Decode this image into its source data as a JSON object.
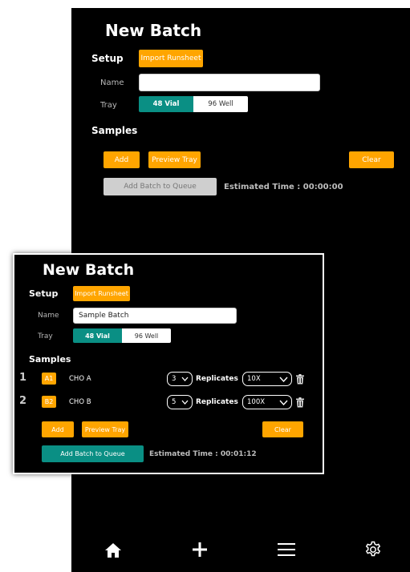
{
  "back_screen": {
    "title": "New Batch",
    "setup_label": "Setup",
    "import_button": "Import Runsheet",
    "name_label": "Name",
    "name_value": "",
    "tray_label": "Tray",
    "tray_options": [
      "48 Vial",
      "96 Well"
    ],
    "tray_selected": "48 Vial",
    "samples_label": "Samples",
    "add_button": "Add",
    "preview_button": "Preview Tray",
    "clear_button": "Clear",
    "queue_button": "Add Batch to Queue",
    "estimated_time": "Estimated Time : 00:00:00"
  },
  "front_panel": {
    "title": "New Batch",
    "setup_label": "Setup",
    "import_button": "Import Runsheet",
    "name_label": "Name",
    "name_value": "Sample Batch",
    "tray_label": "Tray",
    "tray_options": [
      "48 Vial",
      "96 Well"
    ],
    "tray_selected": "48 Vial",
    "samples_label": "Samples",
    "samples": [
      {
        "number": "1",
        "well": "A1",
        "name": "CHO A",
        "replicate_count": "3",
        "replicates_label": "Replicates",
        "dilution": "10X"
      },
      {
        "number": "2",
        "well": "B2",
        "name": "CHO B",
        "replicate_count": "5",
        "replicates_label": "Replicates",
        "dilution": "100X"
      }
    ],
    "add_button": "Add",
    "preview_button": "Preview Tray",
    "clear_button": "Clear",
    "queue_button": "Add Batch to Queue",
    "estimated_time": "Estimated Time : 00:01:12"
  },
  "bottom_nav": {
    "items": [
      "home-icon",
      "plus-icon",
      "menu-icon",
      "gear-icon"
    ]
  },
  "colors": {
    "accent": "#FFA500",
    "teal": "#0A8F84",
    "background": "#000000",
    "disabled": "#cfcfcf"
  }
}
